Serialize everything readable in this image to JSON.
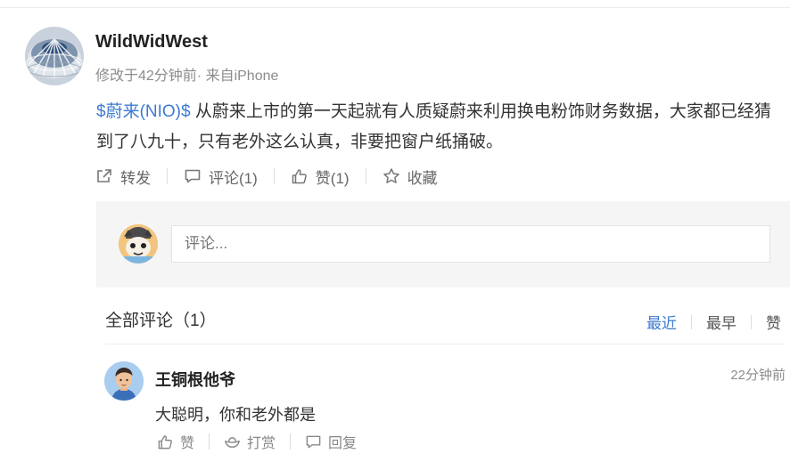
{
  "post": {
    "username": "WildWidWest",
    "meta": "修改于42分钟前· 来自iPhone",
    "stock_tag": "$蔚来(NIO)$",
    "text": " 从蔚来上市的第一天起就有人质疑蔚来利用换电粉饰财务数据，大家都已经猜到了八九十，只有老外这么认真，非要把窗户纸捅破。",
    "actions": {
      "repost": "转发",
      "comment": "评论(1)",
      "like": "赞(1)",
      "favorite": "收藏"
    }
  },
  "reply_box": {
    "placeholder": "评论..."
  },
  "comments_header": {
    "title": "全部评论（1）",
    "sort": {
      "latest": "最近",
      "earliest": "最早",
      "likes": "赞"
    }
  },
  "comments": [
    {
      "username": "王铜根他爷",
      "time": "22分钟前",
      "text": "大聪明，你和老外都是",
      "actions": {
        "like": "赞",
        "reward": "打赏",
        "reply": "回复"
      }
    }
  ],
  "colors": {
    "link": "#3d7ad2",
    "muted": "#8c8c8c",
    "box_bg": "#f5f5f5"
  }
}
